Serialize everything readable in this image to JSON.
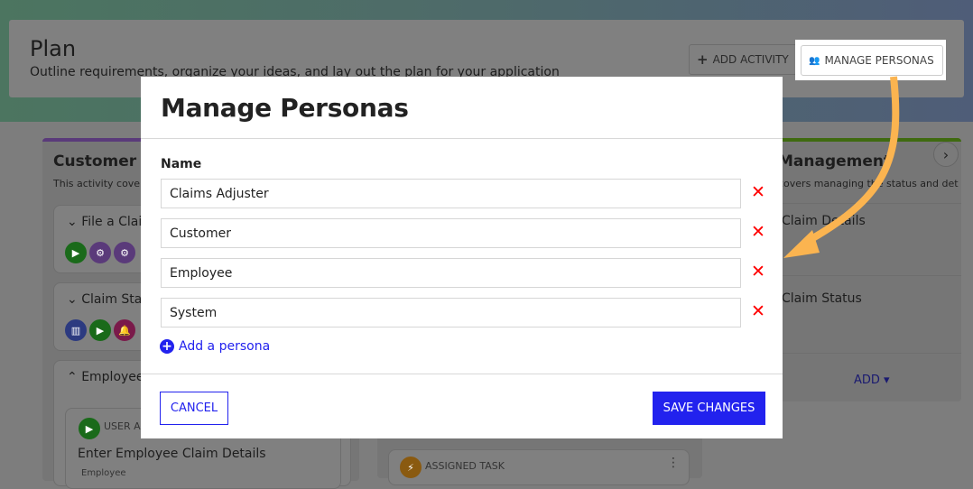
{
  "header": {
    "title": "Plan",
    "subtitle": "Outline requirements, organize your ideas, and lay out the plan for your application",
    "add_activity": "ADD ACTIVITY",
    "manage_personas": "MANAGE PERSONAS"
  },
  "background": {
    "left_column": {
      "title": "Customer C",
      "desc": "This activity cover",
      "groups": [
        "File a Clain",
        "Claim Stat",
        "Employee"
      ],
      "card": {
        "type": "USER AC",
        "title": "Enter Employee Claim Details",
        "persona": "Employee"
      }
    },
    "middle_column": {
      "card": {
        "type": "ASSIGNED TASK"
      }
    },
    "right_column": {
      "title": "Management",
      "desc": "covers managing the status and det",
      "items": [
        "Claim Details",
        "Claim Status"
      ],
      "add": "ADD"
    }
  },
  "modal": {
    "title": "Manage Personas",
    "name_label": "Name",
    "personas": [
      "Claims Adjuster",
      "Customer",
      "Employee",
      "System"
    ],
    "add_persona": "Add a persona",
    "cancel": "CANCEL",
    "save": "SAVE CHANGES"
  },
  "colors": {
    "accent": "#2222ee",
    "delete": "#ff0000",
    "arrow": "#fbb450"
  }
}
